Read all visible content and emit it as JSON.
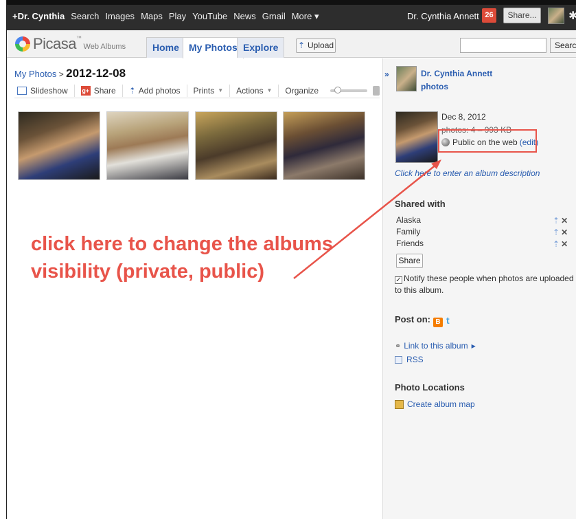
{
  "gbar": {
    "links": [
      "+Dr. Cynthia",
      "Search",
      "Images",
      "Maps",
      "Play",
      "YouTube",
      "News",
      "Gmail",
      "More ▾"
    ],
    "user_name": "Dr. Cynthia Annett",
    "notification_count": "26",
    "share_label": "Share..."
  },
  "header": {
    "logo_text": "Picasa",
    "logo_tm": "™",
    "logo_sub": "Web Albums",
    "tabs": [
      "Home",
      "My Photos",
      "Explore"
    ],
    "active_tab": "My Photos",
    "upload_label": "Upload",
    "search_placeholder": "",
    "search_button": "Search"
  },
  "breadcrumb": {
    "parent": "My Photos",
    "separator": ">",
    "current": "2012-12-08"
  },
  "toolbar": {
    "slideshow": "Slideshow",
    "share": "Share",
    "add_photos": "Add photos",
    "prints": "Prints",
    "actions": "Actions",
    "organize": "Organize"
  },
  "photos": [
    {
      "icon": "photo-thumbnail"
    },
    {
      "icon": "photo-thumbnail"
    },
    {
      "icon": "photo-thumbnail"
    },
    {
      "icon": "photo-thumbnail"
    }
  ],
  "callout": {
    "line1": "click here to change the albums",
    "line2": "visibility (private, public)",
    "color": "#e8544a"
  },
  "sidebar": {
    "collapse_glyph": "»",
    "owner_name": "Dr. Cynthia Annett",
    "owner_sub": "photos",
    "album_date": "Dec 8, 2012",
    "album_meta": "photos: 4 – 993 KB",
    "visibility": "Public on the web",
    "visibility_edit": "(edit)",
    "description_link": "Click here to enter an album description",
    "shared_with_title": "Shared with",
    "shared_with": [
      "Alaska",
      "Family",
      "Friends"
    ],
    "share_button": "Share",
    "notify_text": "Notify these people when photos are uploaded to this album.",
    "notify_checked": true,
    "post_on": "Post on:",
    "link_album": "Link to this album",
    "rss": "RSS",
    "photo_locations_title": "Photo Locations",
    "create_map": "Create album map"
  },
  "colors": {
    "accent_link": "#2a5db0",
    "callout_red": "#e8544a",
    "gbar_bg": "#2d2d2d"
  }
}
